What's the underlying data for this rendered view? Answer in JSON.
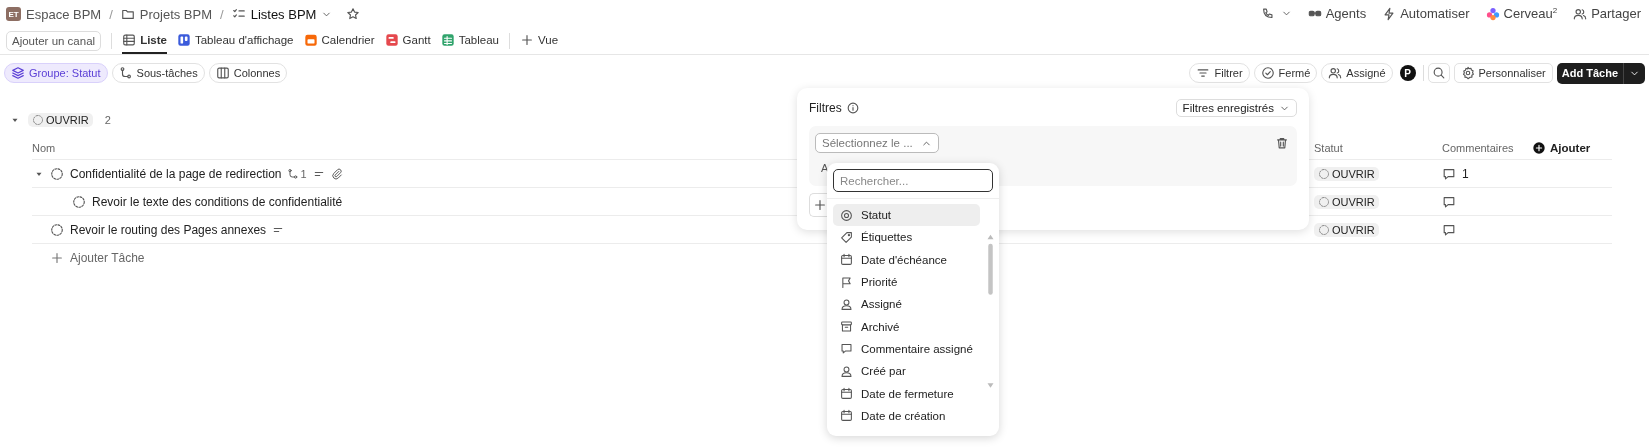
{
  "breadcrumb": {
    "space_initials": "ET",
    "separator": "/",
    "items": [
      {
        "label": "Espace BPM",
        "kind": "space"
      },
      {
        "label": "Projets BPM",
        "kind": "folder"
      },
      {
        "label": "Listes BPM",
        "kind": "list",
        "current": true
      }
    ]
  },
  "header_actions": [
    {
      "label": "Agents",
      "kind": "agents"
    },
    {
      "label": "Automatiser",
      "kind": "bolt"
    },
    {
      "label": "Cerveau$^{2}$",
      "kind": "brain"
    },
    {
      "label": "Partager",
      "kind": "share"
    }
  ],
  "add_channel": "Ajouter un canal",
  "views": [
    {
      "label": "Liste",
      "kind": "list",
      "selected": true
    },
    {
      "label": "Tableau d'affichage",
      "kind": "board",
      "selected": false
    },
    {
      "label": "Calendrier",
      "kind": "calendar",
      "selected": false
    },
    {
      "label": "Gantt",
      "kind": "gantt",
      "selected": false
    },
    {
      "label": "Tableau",
      "kind": "sheet",
      "selected": false
    }
  ],
  "add_view": "Vue",
  "toolbar_left": [
    {
      "label": "Groupe: Statut",
      "kind": "layers",
      "selected": true
    },
    {
      "label": "Sous-tâches",
      "kind": "subtasks",
      "selected": false
    },
    {
      "label": "Colonnes",
      "kind": "columns",
      "selected": false
    }
  ],
  "toolbar_right": [
    {
      "label": "Filtrer",
      "kind": "filter"
    },
    {
      "label": "Fermé",
      "kind": "check"
    },
    {
      "label": "Assigné",
      "kind": "share"
    }
  ],
  "user_initial": "P",
  "customize": "Personnaliser",
  "add_task": "Add Tâche",
  "group": {
    "status": "OUVRIR",
    "count": "2",
    "expanded": true
  },
  "columns": {
    "name": "Nom",
    "status": "Statut",
    "comments": "Commentaires",
    "add": "Ajouter"
  },
  "tasks": [
    {
      "name": "Confidentialité de la page de redirection",
      "expanded": true,
      "subtask_count": "1",
      "has_description": true,
      "has_attachment": true,
      "status": "OUVRIR",
      "comments": "1",
      "children": [
        {
          "name": "Revoir le texte des conditions de confidentialité",
          "status": "OUVRIR"
        }
      ]
    },
    {
      "name": "Revoir le routing des Pages annexes",
      "has_description": true,
      "status": "OUVRIR"
    }
  ],
  "add_task_row": "Ajouter Tâche",
  "filter_panel": {
    "title": "Filtres",
    "saved_filters": "Filtres enregistrés",
    "field_select": "Sélectionnez le ...",
    "field_open": true,
    "hidden_label": "A",
    "search_placeholder": "Rechercher...",
    "options": [
      {
        "label": "Statut",
        "kind": "status",
        "selected": true
      },
      {
        "label": "Étiquettes",
        "kind": "tag",
        "selected": false
      },
      {
        "label": "Date d'échéance",
        "kind": "date",
        "selected": false
      },
      {
        "label": "Priorité",
        "kind": "flag",
        "selected": false
      },
      {
        "label": "Assigné",
        "kind": "person",
        "selected": false
      },
      {
        "label": "Archivé",
        "kind": "archive",
        "selected": false
      },
      {
        "label": "Commentaire assigné",
        "kind": "comment",
        "selected": false
      },
      {
        "label": "Créé par",
        "kind": "person",
        "selected": false
      },
      {
        "label": "Date de fermeture",
        "kind": "date",
        "selected": false
      },
      {
        "label": "Date de création",
        "kind": "date",
        "selected": false
      }
    ]
  }
}
